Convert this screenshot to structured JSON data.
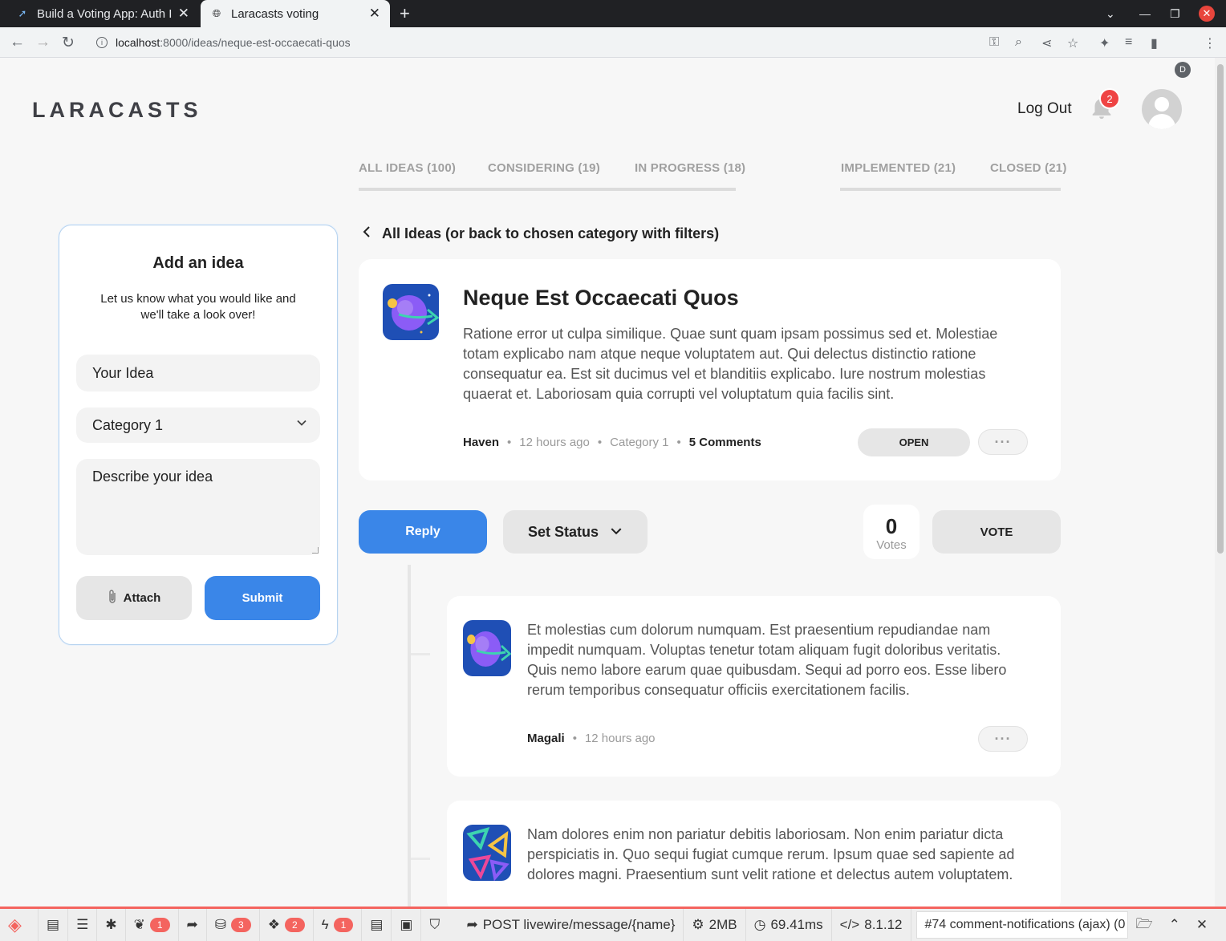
{
  "browser": {
    "tabs": [
      {
        "title": "Build a Voting App: Auth I",
        "icon": "laracasts-favicon"
      },
      {
        "title": "Laracasts voting",
        "icon": "globe-icon"
      }
    ],
    "url_host": "localhost",
    "url_path": ":8000/ideas/neque-est-occaecati-quos",
    "profile_initial": "D"
  },
  "header": {
    "logo": "LARACASTS",
    "logout_label": "Log Out",
    "notification_count": "2"
  },
  "filters": [
    {
      "label": "ALL IDEAS (100)"
    },
    {
      "label": "CONSIDERING (19)"
    },
    {
      "label": "IN PROGRESS (18)"
    },
    {
      "label": "IMPLEMENTED (21)"
    },
    {
      "label": "CLOSED (21)"
    }
  ],
  "add_idea": {
    "title": "Add an idea",
    "subtitle": "Let us know what you would like and we'll take a look over!",
    "idea_placeholder": "Your Idea",
    "category_value": "Category 1",
    "description_placeholder": "Describe your idea",
    "attach_label": "Attach",
    "submit_label": "Submit"
  },
  "back_link": "All Ideas (or back to chosen category with filters)",
  "idea": {
    "title": "Neque Est Occaecati Quos",
    "description": "Ratione error ut culpa similique. Quae sunt quam ipsam possimus sed et. Molestiae totam explicabo nam atque neque voluptatem aut. Qui delectus distinctio ratione consequatur ea. Est sit ducimus vel et blanditiis explicabo. Iure nostrum molestias quaerat et. Laboriosam quia corrupti vel voluptatum quia facilis sint.",
    "author": "Haven",
    "time": "12 hours ago",
    "category": "Category 1",
    "comments": "5 Comments",
    "status": "OPEN",
    "more": "···"
  },
  "actions": {
    "reply_label": "Reply",
    "set_status_label": "Set Status",
    "votes_count": "0",
    "votes_label": "Votes",
    "vote_button": "VOTE"
  },
  "comments": [
    {
      "text": "Et molestias cum dolorum numquam. Est praesentium repudiandae nam impedit numquam. Voluptas tenetur totam aliquam fugit doloribus veritatis. Quis nemo labore earum quae quibusdam. Sequi ad porro eos. Esse libero rerum temporibus consequatur officiis exercitationem facilis.",
      "author": "Magali",
      "time": "12 hours ago",
      "more": "···"
    },
    {
      "text": "Nam dolores enim non pariatur debitis laboriosam. Non enim pariatur dicta perspiciatis in. Quo sequi fugiat cumque rerum. Ipsum quae sed sapiente ad dolores magni. Praesentium sunt velit ratione et delectus autem voluptatem."
    }
  ],
  "debugbar": {
    "logs_count": "1",
    "queries_count": "3",
    "models_count": "2",
    "livewire_count": "1",
    "route": "POST livewire/message/{name}",
    "memory": "2MB",
    "time": "69.41ms",
    "php_version": "8.1.12",
    "request": "#74 comment-notifications (ajax) (0"
  }
}
